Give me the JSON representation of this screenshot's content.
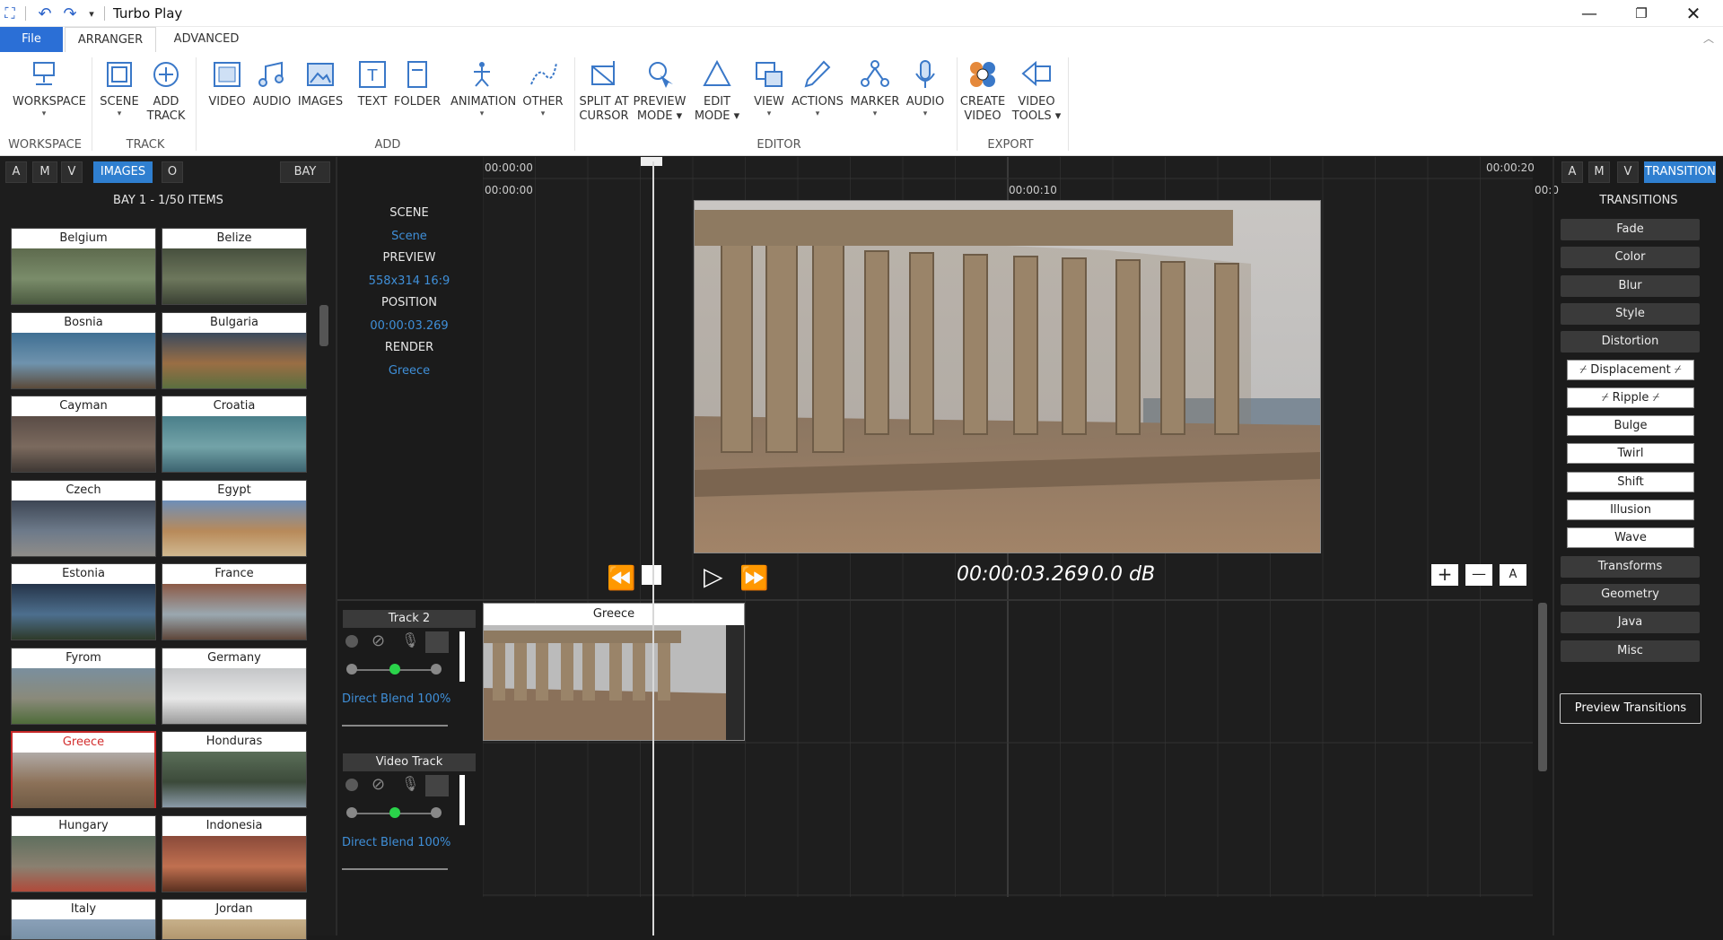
{
  "app": {
    "title": "Turbo Play"
  },
  "tabs": [
    "File",
    "ARRANGER",
    "ADVANCED"
  ],
  "ribbon": {
    "buttons": [
      {
        "label1": "WORKSPACE",
        "label2": "",
        "dropdown": true,
        "icon": "workspace-icon"
      },
      {
        "label1": "SCENE",
        "label2": "",
        "dropdown": true,
        "icon": "scene-icon"
      },
      {
        "label1": "ADD",
        "label2": "TRACK",
        "dropdown": false,
        "icon": "add-track-icon"
      },
      {
        "label1": "VIDEO",
        "label2": "",
        "dropdown": false,
        "icon": "video-icon"
      },
      {
        "label1": "AUDIO",
        "label2": "",
        "dropdown": false,
        "icon": "audio-icon"
      },
      {
        "label1": "IMAGES",
        "label2": "",
        "dropdown": false,
        "icon": "images-icon"
      },
      {
        "label1": "TEXT",
        "label2": "",
        "dropdown": false,
        "icon": "text-icon"
      },
      {
        "label1": "FOLDER",
        "label2": "",
        "dropdown": false,
        "icon": "folder-icon"
      },
      {
        "label1": "ANIMATION",
        "label2": "",
        "dropdown": true,
        "icon": "animation-icon"
      },
      {
        "label1": "OTHER",
        "label2": "",
        "dropdown": true,
        "icon": "other-icon"
      },
      {
        "label1": "SPLIT AT",
        "label2": "CURSOR",
        "dropdown": false,
        "icon": "split-icon"
      },
      {
        "label1": "PREVIEW",
        "label2": "MODE ▾",
        "dropdown": false,
        "icon": "preview-mode-icon"
      },
      {
        "label1": "EDIT",
        "label2": "MODE ▾",
        "dropdown": false,
        "icon": "edit-mode-icon"
      },
      {
        "label1": "VIEW",
        "label2": "",
        "dropdown": true,
        "icon": "view-icon"
      },
      {
        "label1": "ACTIONS",
        "label2": "",
        "dropdown": true,
        "icon": "actions-icon"
      },
      {
        "label1": "MARKER",
        "label2": "",
        "dropdown": true,
        "icon": "marker-icon"
      },
      {
        "label1": "AUDIO",
        "label2": "",
        "dropdown": true,
        "icon": "mic-icon"
      },
      {
        "label1": "CREATE",
        "label2": "VIDEO",
        "dropdown": false,
        "icon": "create-video-icon"
      },
      {
        "label1": "VIDEO",
        "label2": "TOOLS ▾",
        "dropdown": false,
        "icon": "video-tools-icon"
      }
    ],
    "groups": [
      "WORKSPACE",
      "TRACK",
      "ADD",
      "EDITOR",
      "EXPORT"
    ]
  },
  "bay": {
    "filters": [
      "A",
      "M",
      "V",
      "IMAGES",
      "O"
    ],
    "bay_button": "BAY",
    "title": "BAY 1 - 1/50 ITEMS",
    "items": [
      "Belgium",
      "Belize",
      "Bosnia",
      "Bulgaria",
      "Cayman",
      "Croatia",
      "Czech",
      "Egypt",
      "Estonia",
      "France",
      "Fyrom",
      "Germany",
      "Greece",
      "Honduras",
      "Hungary",
      "Indonesia",
      "Italy",
      "Jordan"
    ],
    "selected": "Greece"
  },
  "info": {
    "scene_h": "SCENE",
    "scene_v": "Scene",
    "preview_h": "PREVIEW",
    "preview_v": "558x314 16:9",
    "position_h": "POSITION",
    "position_v": "00:00:03.269",
    "render_h": "RENDER",
    "render_v": "Greece"
  },
  "ruler": {
    "top_left": "00:00:00",
    "top_right": "00:00:20",
    "mid_left": "00:00:00",
    "mid_center": "00:00:10",
    "mid_right": "00:0"
  },
  "transport": {
    "time": "00:00:03.269",
    "db": "0.0 dB",
    "auto_label": "A"
  },
  "tracks": [
    {
      "name": "Track 2",
      "blend": "Direct Blend 100%",
      "clip": "Greece"
    },
    {
      "name": "Video Track",
      "blend": "Direct Blend 100%",
      "clip": ""
    }
  ],
  "right": {
    "filters": [
      "A",
      "M",
      "V",
      "TRANSITION"
    ],
    "title": "TRANSITIONS",
    "categories_top": [
      "Fade",
      "Color",
      "Blur",
      "Style",
      "Distortion"
    ],
    "distortion_items": [
      "⌿ Displacement ⌿",
      "⌿ Ripple ⌿",
      "Bulge",
      "Twirl",
      "Shift",
      "Illusion",
      "Wave"
    ],
    "categories_bottom": [
      "Transforms",
      "Geometry",
      "Java",
      "Misc"
    ],
    "preview_button": "Preview Transitions"
  },
  "colors": {
    "accent": "#2f7fd0",
    "selected": "#d32f2f",
    "playhead": "#ffffff"
  }
}
